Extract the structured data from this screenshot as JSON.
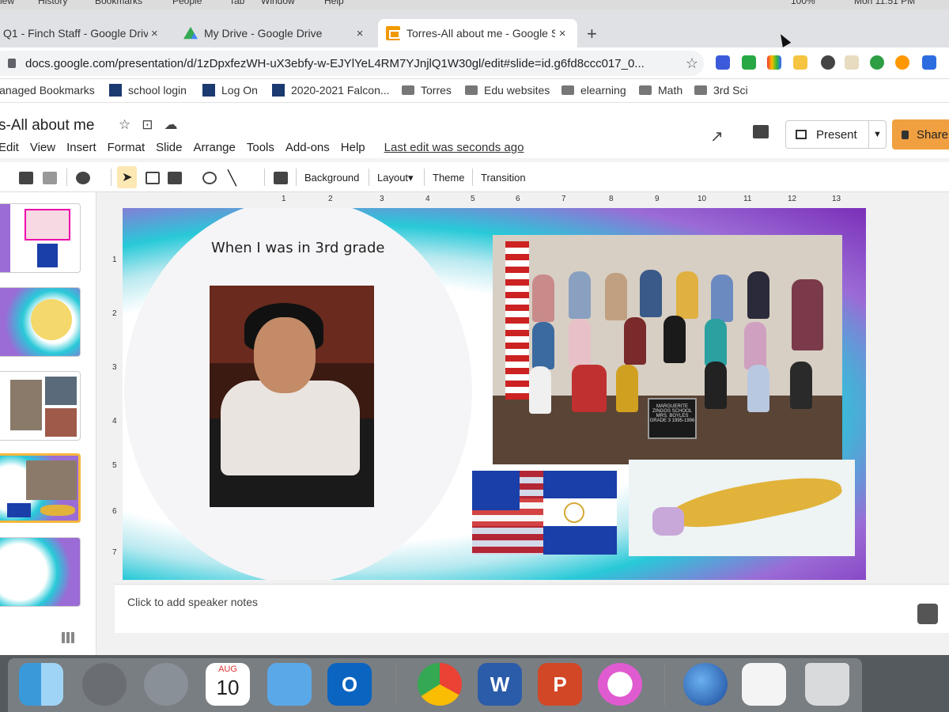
{
  "menubar": {
    "items": [
      "iew",
      "History",
      "Bookmarks",
      "People",
      "Tab",
      "Window",
      "Help"
    ],
    "status": {
      "battery": "100%",
      "clock": "Mon 11:51 PM"
    }
  },
  "tabs": [
    {
      "label": "Q1 - Finch Staff - Google Drive",
      "close": "×"
    },
    {
      "label": "My Drive - Google Drive",
      "close": "×"
    },
    {
      "label": "Torres-All about me - Google S",
      "close": "×"
    }
  ],
  "new_tab": "+",
  "address": {
    "url": "docs.google.com/presentation/d/1zDpxfezWH-uX3ebfy-w-EJYlYeL4RM7YJnjlQ1W30gl/edit#slide=id.g6fd8ccc017_0...",
    "star": "☆"
  },
  "bookmarks": [
    {
      "label": "lanaged Bookmarks"
    },
    {
      "label": "school login"
    },
    {
      "label": "Log On"
    },
    {
      "label": "2020-2021 Falcon..."
    },
    {
      "label": "Torres"
    },
    {
      "label": "Edu websites"
    },
    {
      "label": "elearning"
    },
    {
      "label": "Math"
    },
    {
      "label": "3rd Sci"
    }
  ],
  "doc": {
    "title": "s-All about me",
    "menus": [
      "Edit",
      "View",
      "Insert",
      "Format",
      "Slide",
      "Arrange",
      "Tools",
      "Add-ons",
      "Help"
    ],
    "last_edit": "Last edit was seconds ago",
    "present": "Present",
    "share": "Share"
  },
  "toolbar": {
    "background": "Background",
    "layout": "Layout▾",
    "theme": "Theme",
    "transition": "Transition"
  },
  "ruler": {
    "h": [
      "1",
      "2",
      "3",
      "4",
      "5",
      "6",
      "7",
      "8",
      "9",
      "10",
      "11",
      "12",
      "13"
    ],
    "v": [
      "1",
      "2",
      "3",
      "4",
      "5",
      "6",
      "7"
    ]
  },
  "slide": {
    "heading": "When I was in 3rd grade",
    "board_text": "MARGUERITE ZINGGS SCHOOL MRS. BOYLES GRADE 3 1995-1996"
  },
  "notes_placeholder": "Click to add speaker notes",
  "dock": {
    "calendar_month": "AUG",
    "calendar_day": "10",
    "outlook_letter": "O",
    "word_letter": "W",
    "powerpoint_letter": "P"
  },
  "colors": {
    "accent_share": "#f0a040",
    "selected_thumb": "#f6b73c"
  }
}
